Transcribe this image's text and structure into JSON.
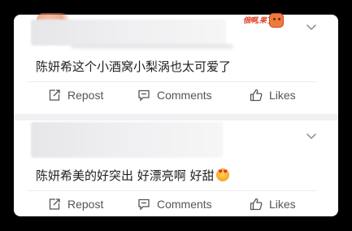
{
  "posts": [
    {
      "comment": "陈妍希这个小酒窝小梨涡也太可爱了",
      "badge_text": "俄啊,果了"
    },
    {
      "comment": "陈妍希美的好突出 好漂亮啊 好甜"
    }
  ],
  "actions": {
    "repost": "Repost",
    "comments": "Comments",
    "likes": "Likes"
  },
  "emoji_name": "heart-eyes-emoji",
  "colors": {
    "background": "#000000",
    "card": "#ffffff",
    "text": "#222222",
    "action_text": "#555555"
  }
}
